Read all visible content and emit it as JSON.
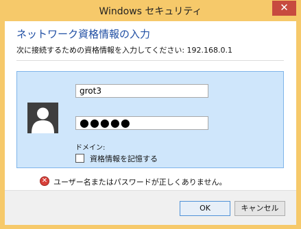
{
  "window": {
    "title": "Windows セキュリティ",
    "close_glyph": "✕"
  },
  "dialog": {
    "heading": "ネットワーク資格情報の入力",
    "instruction": "次に接続するための資格情報を入力してください: 192.168.0.1",
    "username_value": "grot3",
    "password_mask": "●●●●●",
    "domain_label": "ドメイン:",
    "remember_label": "資格情報を記憶する",
    "remember_checked": false,
    "error_message": "ユーザー名またはパスワードが正しくありません。",
    "error_glyph": "✕"
  },
  "buttons": {
    "ok": "OK",
    "cancel": "キャンセル"
  },
  "icons": {
    "avatar": "user-icon",
    "error": "error-icon",
    "close": "close-icon"
  },
  "colors": {
    "titlebar": "#f6c96a",
    "heading": "#1f4ea3",
    "panel": "#cfe6fb",
    "panel_border": "#7eb4ea",
    "close": "#c74a3f",
    "error": "#d8413a"
  }
}
